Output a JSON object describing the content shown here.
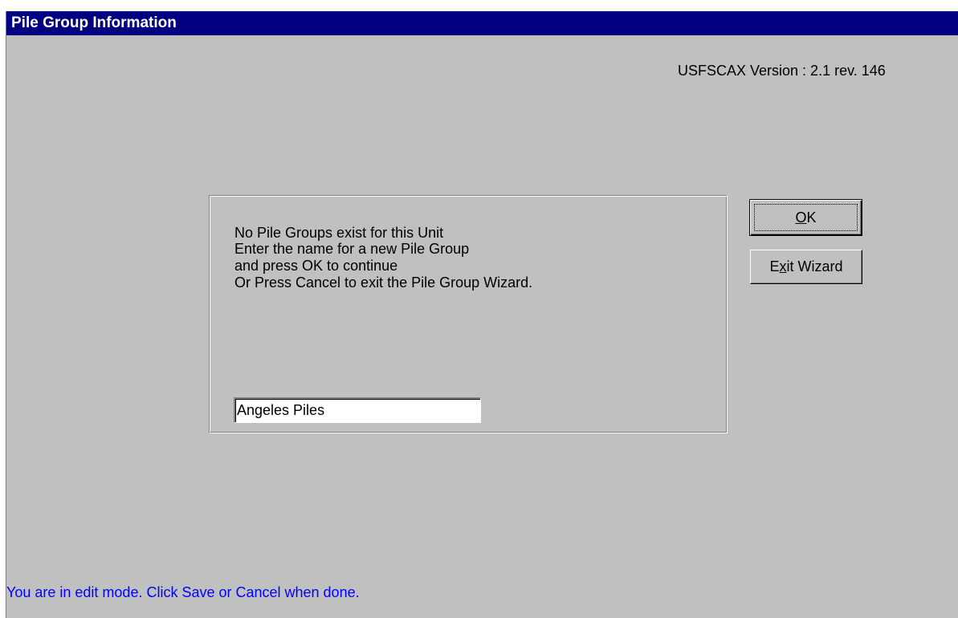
{
  "window": {
    "title": "Pile Group Information"
  },
  "version_label": "USFSCAX Version : 2.1 rev. 146",
  "message": {
    "line1": "No Pile Groups exist for this Unit",
    "line2": "Enter the name for a new Pile Group",
    "line3": "and press OK to continue",
    "line4": "Or Press Cancel to exit the Pile Group Wizard."
  },
  "pile_group_name": {
    "value": "Angeles Piles"
  },
  "buttons": {
    "ok": {
      "underlined": "O",
      "rest": "K"
    },
    "exit_wizard": {
      "before": "E",
      "underlined": "x",
      "rest": "it Wizard"
    }
  },
  "status_text": "You are in edit mode.  Click Save or Cancel when done.",
  "colors": {
    "titlebar": "#000080",
    "window_bg": "#c0c0c0",
    "status_text": "#0000ff"
  }
}
